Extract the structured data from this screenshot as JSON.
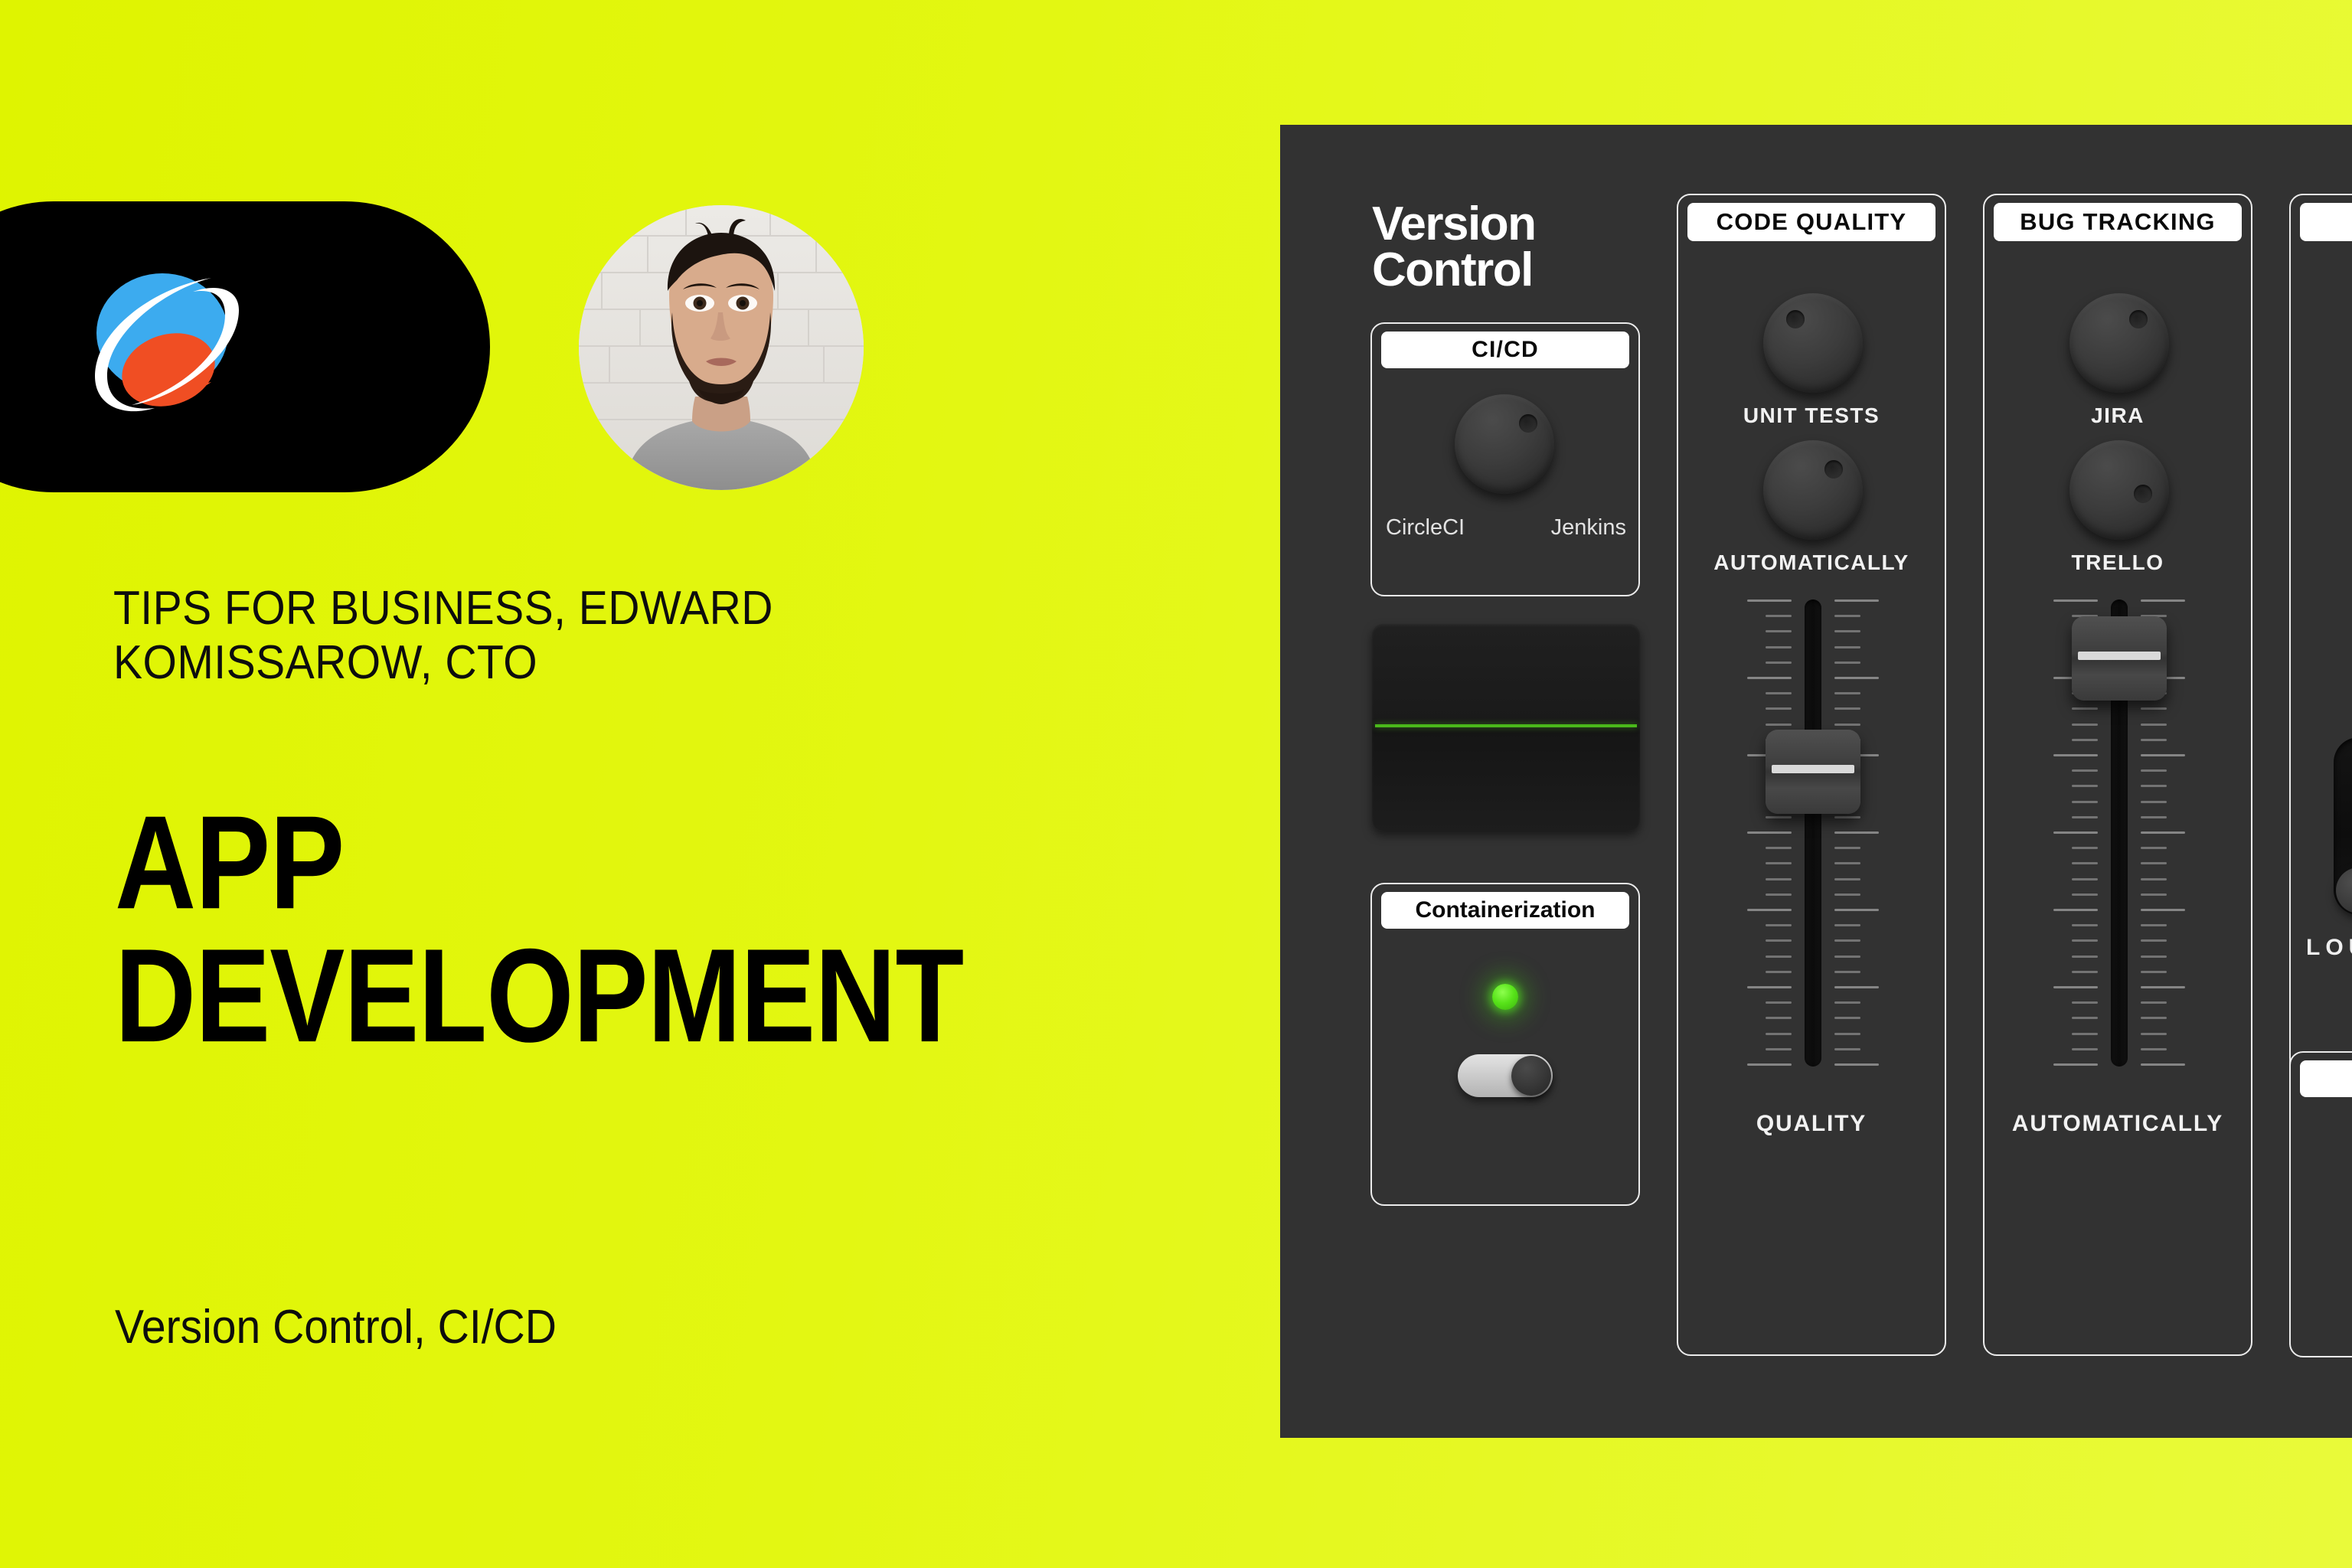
{
  "theme": {
    "background_start": "#dff400",
    "background_end": "#e9fa3a",
    "panel_bg": "#323232",
    "panel_border": "#ebebeb",
    "label_bg": "#ffffff",
    "led_green": "#57e219",
    "scope_line": "#4ab81b",
    "logo_blue": "#3cabef",
    "logo_orange": "#f04e23"
  },
  "left": {
    "logo": {
      "name": "orbit-planet-logo",
      "pill_color": "#000000"
    },
    "avatar": {
      "name": "speaker-portrait",
      "alt": "Portrait of a bearded man in a grey t-shirt in front of a white brick wall"
    },
    "eyebrow": "TIPS FOR BUSINESS, EDWARD KOMISSAROW, CTO",
    "headline_line1": "APP",
    "headline_line2": "DEVELOPMENT",
    "footer_subtitle": "Version Control, CI/CD"
  },
  "mixer": {
    "section_title_line1": "Version",
    "section_title_line2": "Control",
    "cicd": {
      "label": "CI/CD",
      "knob_name": "cicd-selector-knob",
      "option_left": "CircleCI",
      "option_right": "Jenkins"
    },
    "scope": {
      "name": "waveform-display",
      "signal": "flat"
    },
    "containerization": {
      "label": "Containerization",
      "led_state": "on",
      "toggle_state": "on"
    },
    "strips": [
      {
        "label": "CODE QUALITY",
        "knob1": "UNIT TESTS",
        "knob2": "AUTOMATICALLY",
        "fader_label": "QUALITY",
        "fader_position_pct": 55
      },
      {
        "label": "BUG TRACKING",
        "knob1": "JIRA",
        "knob2": "TRELLO",
        "fader_label": "AUTOMATICALLY",
        "fader_position_pct": 93
      },
      {
        "label": "",
        "knob1": "",
        "knob2": "",
        "fader_label": "",
        "fader_position_pct": 0
      }
    ],
    "extra": {
      "slider_label": "LOUD",
      "slider_position": "bottom"
    }
  }
}
